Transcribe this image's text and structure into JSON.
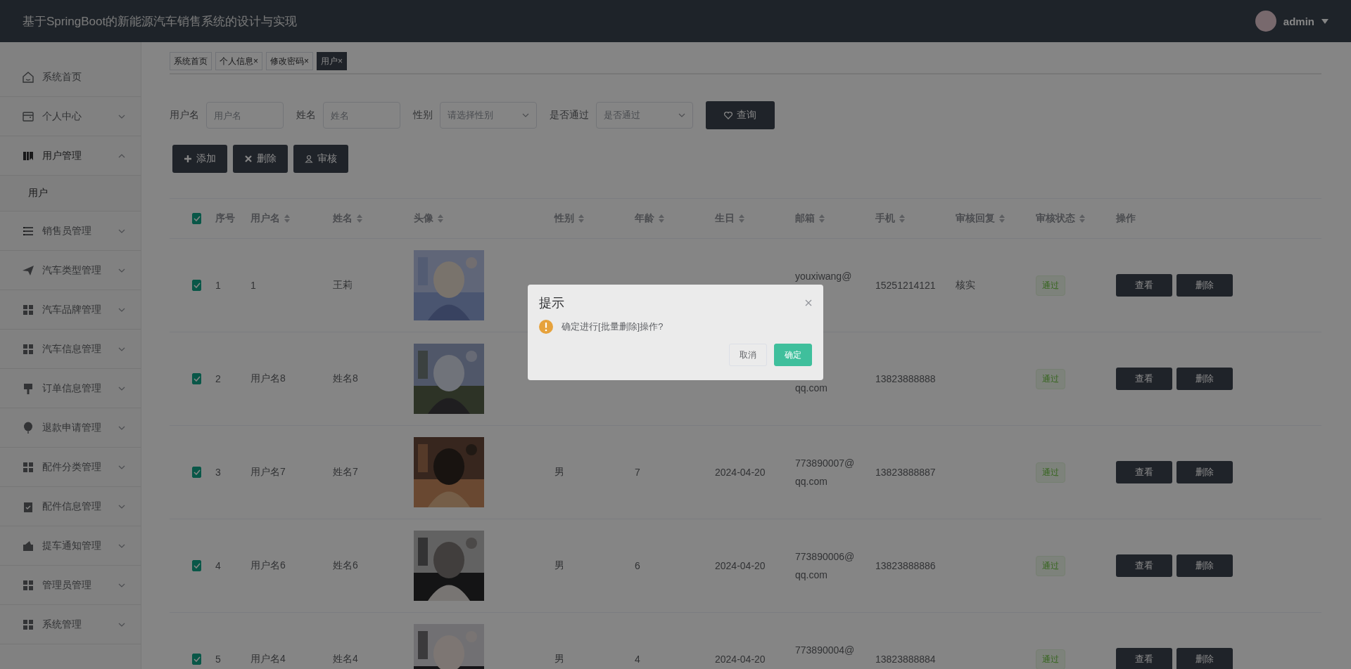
{
  "header": {
    "title": "基于SpringBoot的新能源汽车销售系统的设计与实现",
    "user": {
      "name": "admin"
    }
  },
  "sidebar": {
    "items": [
      {
        "label": "系统首页",
        "kind": "link",
        "expanded": false
      },
      {
        "label": "个人中心",
        "kind": "submenu",
        "expanded": false
      },
      {
        "label": "用户管理",
        "kind": "submenu",
        "expanded": true,
        "children": [
          {
            "label": "用户"
          }
        ]
      },
      {
        "label": "销售员管理",
        "kind": "submenu",
        "expanded": false
      },
      {
        "label": "汽车类型管理",
        "kind": "submenu",
        "expanded": false
      },
      {
        "label": "汽车品牌管理",
        "kind": "submenu",
        "expanded": false
      },
      {
        "label": "汽车信息管理",
        "kind": "submenu",
        "expanded": false
      },
      {
        "label": "订单信息管理",
        "kind": "submenu",
        "expanded": false
      },
      {
        "label": "退款申请管理",
        "kind": "submenu",
        "expanded": false
      },
      {
        "label": "配件分类管理",
        "kind": "submenu",
        "expanded": false
      },
      {
        "label": "配件信息管理",
        "kind": "submenu",
        "expanded": false
      },
      {
        "label": "提车通知管理",
        "kind": "submenu",
        "expanded": false
      },
      {
        "label": "管理员管理",
        "kind": "submenu",
        "expanded": false
      },
      {
        "label": "系统管理",
        "kind": "submenu",
        "expanded": false
      }
    ]
  },
  "tabs": [
    {
      "label": "系统首页",
      "selected": false
    },
    {
      "label": "个人信息",
      "close": "×",
      "selected": false
    },
    {
      "label": "修改密码",
      "close": "×",
      "selected": false
    },
    {
      "label": "用户",
      "close": "×",
      "selected": true
    }
  ],
  "search": {
    "fields": [
      {
        "label": "用户名",
        "kind": "input",
        "placeholder": "用户名"
      },
      {
        "label": "姓名",
        "kind": "input",
        "placeholder": "姓名"
      },
      {
        "label": "性别",
        "kind": "select",
        "placeholder": "请选择性别"
      },
      {
        "label": "是否通过",
        "kind": "select",
        "placeholder": "是否通过"
      }
    ],
    "button": "查询"
  },
  "toolbar": [
    {
      "label": "添加",
      "kind": "add"
    },
    {
      "label": "删除",
      "kind": "delete"
    },
    {
      "label": "审核",
      "kind": "review"
    }
  ],
  "table": {
    "select_all": true,
    "columns": [
      {
        "label": "序号",
        "sortable": false
      },
      {
        "label": "用户名",
        "sortable": true
      },
      {
        "label": "姓名",
        "sortable": true
      },
      {
        "label": "头像",
        "sortable": true
      },
      {
        "label": "性别",
        "sortable": true
      },
      {
        "label": "年龄",
        "sortable": true
      },
      {
        "label": "生日",
        "sortable": true
      },
      {
        "label": "邮箱",
        "sortable": true
      },
      {
        "label": "手机",
        "sortable": true
      },
      {
        "label": "审核回复",
        "sortable": true
      },
      {
        "label": "审核状态",
        "sortable": true
      },
      {
        "label": "操作",
        "sortable": false
      }
    ],
    "rows": [
      {
        "checked": true,
        "index": "1",
        "username": "1",
        "name": "王莉",
        "avatar": {
          "kind": "picture"
        },
        "email": "youxiwang@",
        "phone": "15251214121",
        "reply": "核实",
        "status": "通过",
        "actions": [
          "查看",
          "删除"
        ]
      },
      {
        "checked": true,
        "index": "2",
        "username": "用户名8",
        "name": "姓名8",
        "avatar": {
          "kind": "picture"
        },
        "email": "qq.com",
        "phone": "13823888888",
        "status": "通过",
        "actions": [
          "查看",
          "删除"
        ]
      },
      {
        "checked": true,
        "index": "3",
        "username": "用户名7",
        "name": "姓名7",
        "avatar": {
          "kind": "picture"
        },
        "gender": "男",
        "age": "7",
        "birthday": "2024-04-20",
        "email": "773890007@qq.com",
        "phone": "13823888887",
        "status": "通过",
        "actions": [
          "查看",
          "删除"
        ]
      },
      {
        "checked": true,
        "index": "4",
        "username": "用户名6",
        "name": "姓名6",
        "avatar": {
          "kind": "picture"
        },
        "gender": "男",
        "age": "6",
        "birthday": "2024-04-20",
        "email": "773890006@qq.com",
        "phone": "13823888886",
        "status": "通过",
        "actions": [
          "查看",
          "删除"
        ]
      },
      {
        "checked": true,
        "index": "5",
        "username": "用户名4",
        "name": "姓名4",
        "avatar": {
          "kind": "picture"
        },
        "gender": "男",
        "age": "4",
        "birthday": "2024-04-20",
        "email": "773890004@",
        "phone": "13823888884",
        "status": "通过",
        "actions": [
          "查看",
          "删除"
        ]
      }
    ]
  },
  "dialog": {
    "title": "提示",
    "message": "确定进行[批量删除]操作?",
    "buttons": [
      {
        "label": "取消",
        "kind": "cancel"
      },
      {
        "label": "确定",
        "kind": "confirm"
      }
    ]
  }
}
